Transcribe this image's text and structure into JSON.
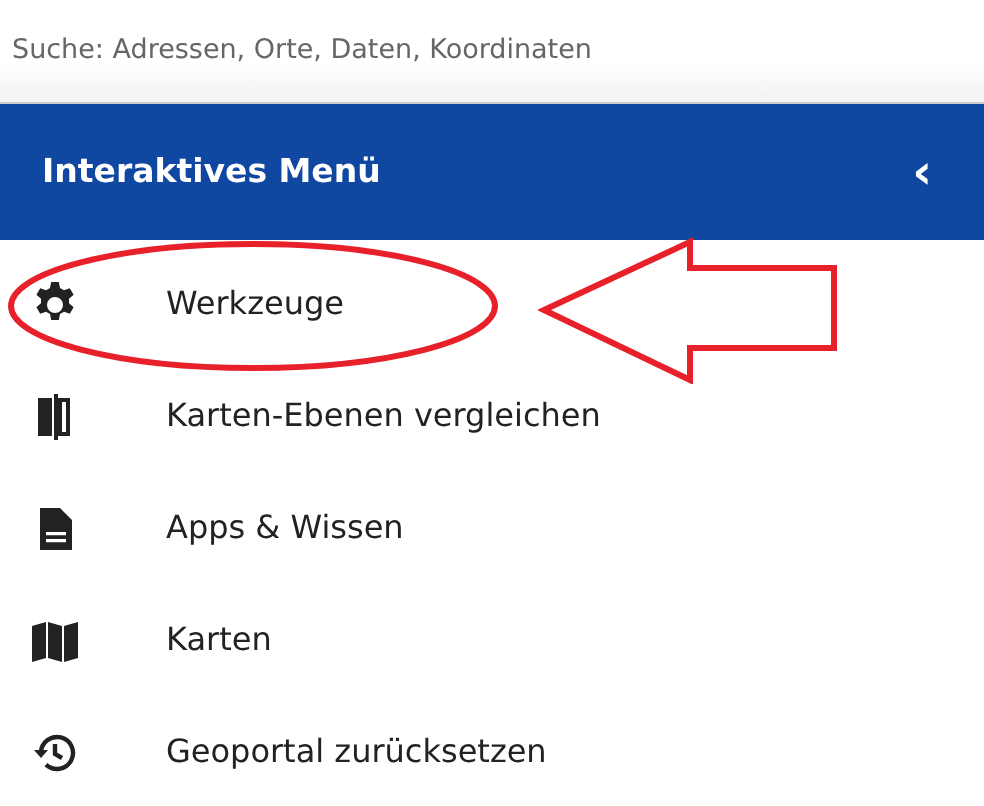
{
  "search": {
    "placeholder": "Suche: Adressen, Orte, Daten, Koordinaten"
  },
  "menu": {
    "title": "Interaktives Menü",
    "collapse_glyph": "‹",
    "items": [
      {
        "label": "Werkzeuge",
        "highlighted": true
      },
      {
        "label": "Karten-Ebenen vergleichen",
        "highlighted": false
      },
      {
        "label": "Apps & Wissen",
        "highlighted": false
      },
      {
        "label": "Karten",
        "highlighted": false
      },
      {
        "label": "Geoportal zurücksetzen",
        "highlighted": false
      }
    ]
  }
}
